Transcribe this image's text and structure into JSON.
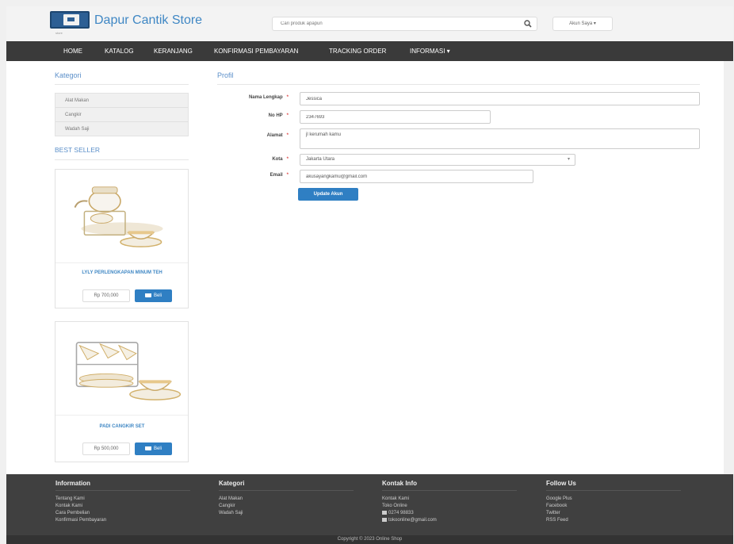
{
  "header": {
    "brand": "Dapur Cantik Store",
    "logo_sub": "store",
    "search_placeholder": "Cari produk apapun",
    "account_label": "Akun Saya ▾"
  },
  "nav": {
    "items": [
      "HOME",
      "KATALOG",
      "KERANJANG",
      "KONFIRMASI PEMBAYARAN",
      "TRACKING ORDER",
      "INFORMASI ▾"
    ]
  },
  "sidebar": {
    "category_title": "Kategori",
    "categories": [
      "Alat Makan",
      "Cangkir",
      "Wadah Saji"
    ],
    "bestseller_title": "BEST SELLER",
    "products": [
      {
        "name": "LYLY PERLENGKAPAN MINUM TEH",
        "price": "Rp 700,000",
        "buy_label": "Beli"
      },
      {
        "name": "PADI CANGKIR SET",
        "price": "Rp 500,000",
        "buy_label": "Beli"
      }
    ]
  },
  "profile": {
    "title": "Profil",
    "fields": {
      "name": {
        "label": "Nama Lengkap",
        "value": "Jessica"
      },
      "phone": {
        "label": "No HP",
        "value": "2347693"
      },
      "address": {
        "label": "Alamat",
        "value": "jl kerumah kamu"
      },
      "city": {
        "label": "Kota",
        "value": "Jakarta Utara"
      },
      "email": {
        "label": "Email",
        "value": "akusayangkamu@gmail.com"
      }
    },
    "required_mark": "*",
    "update_label": "Update Akun"
  },
  "footer": {
    "columns": [
      {
        "title": "Information",
        "links": [
          "Tentang Kami",
          "Kontak Kami",
          "Cara Pembelian",
          "Konfirmasi Pembayaran"
        ]
      },
      {
        "title": "Kategori",
        "links": [
          "Alat Makan",
          "Cangkir",
          "Wadah Saji"
        ]
      },
      {
        "title": "Kontak Info",
        "links": [
          "Kontak Kami",
          "Toko Online",
          "0274 98833",
          "tokoonline@gmail.com"
        ]
      },
      {
        "title": "Follow Us",
        "links": [
          "Google Plus",
          "Facebook",
          "Twitter",
          "RSS Feed"
        ]
      }
    ],
    "copyright": "Copyright © 2023 Online Shop"
  },
  "colors": {
    "accent": "#2f7fc3",
    "brand": "#3f87c4",
    "navbar": "#3a3a3a",
    "footer": "#404040"
  }
}
